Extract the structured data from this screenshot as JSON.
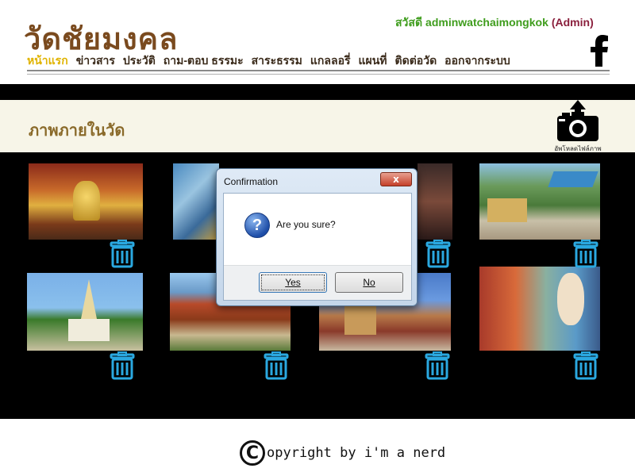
{
  "header": {
    "site_title": "วัดชัยมงคล",
    "greeting": "สวัสดี",
    "username": "adminwatchaimongkok",
    "role": "(Admin)",
    "facebook_icon": "facebook-icon"
  },
  "nav": {
    "items": [
      {
        "label": "หน้าแรก",
        "active": true
      },
      {
        "label": "ข่าวสาร",
        "active": false
      },
      {
        "label": "ประวัติ",
        "active": false
      },
      {
        "label": "ถาม-ตอบ ธรรมะ",
        "active": false
      },
      {
        "label": "สาระธรรม",
        "active": false
      },
      {
        "label": "แกลลอรี่",
        "active": false
      },
      {
        "label": "แผนที่",
        "active": false
      },
      {
        "label": "ติดต่อวัด",
        "active": false
      },
      {
        "label": "ออกจากระบบ",
        "active": false
      }
    ]
  },
  "section": {
    "title": "ภาพภายในวัด",
    "upload_label": "อัพโหลดไฟล์ภาพ"
  },
  "gallery": {
    "photos": [
      {
        "alt": "temple-interior-golden-buddha",
        "delete_icon": "trash-icon"
      },
      {
        "alt": "temple-blue-decorations",
        "delete_icon": "trash-icon"
      },
      {
        "alt": "temple-hall-exterior",
        "delete_icon": "trash-icon"
      },
      {
        "alt": "temple-courtyard-stalls",
        "delete_icon": "trash-icon"
      },
      {
        "alt": "white-golden-stupa",
        "delete_icon": "trash-icon"
      },
      {
        "alt": "temple-red-roof-building",
        "delete_icon": "trash-icon"
      },
      {
        "alt": "temple-tower-blue-sky",
        "delete_icon": "trash-icon"
      },
      {
        "alt": "chinese-guardian-statue",
        "delete_icon": "trash-icon"
      }
    ]
  },
  "footer": {
    "copyright_symbol": "C",
    "text": "opyright by i'm a nerd"
  },
  "dialog": {
    "title": "Confirmation",
    "close": "x",
    "message": "Are you sure?",
    "icon": "question-icon",
    "yes": "Yes",
    "no": "No"
  },
  "colors": {
    "title_brown": "#7a4a1e",
    "greeting_green": "#3f9d1d",
    "role_maroon": "#8a1f3c",
    "nav_active": "#e0b300",
    "trash_blue": "#2aa8e0"
  }
}
